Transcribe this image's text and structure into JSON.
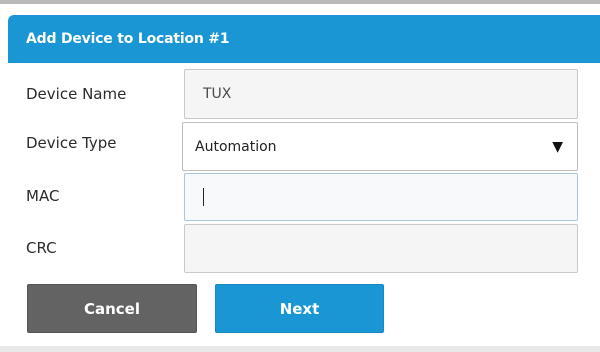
{
  "dialog": {
    "title": "Add Device to Location #1"
  },
  "form": {
    "device_name": {
      "label": "Device Name",
      "value": "TUX"
    },
    "device_type": {
      "label": "Device Type",
      "value": "Automation",
      "icon": "dropdown-arrow-icon"
    },
    "mac": {
      "label": "MAC",
      "value": ""
    },
    "crc": {
      "label": "CRC",
      "value": ""
    }
  },
  "buttons": {
    "cancel_label": "Cancel",
    "next_label": "Next"
  },
  "colors": {
    "header_blue": "#1a96d4",
    "cancel_gray": "#636363",
    "next_blue": "#1a96d4"
  }
}
